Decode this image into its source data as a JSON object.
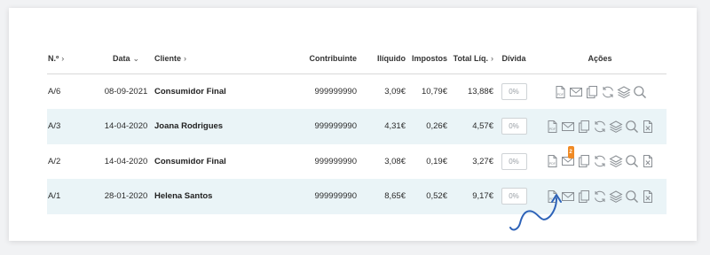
{
  "colors": {
    "accent": "#2d62b8",
    "badge": "#f08a24",
    "row_shade": "#eaf4f7"
  },
  "headers": {
    "numero": "N.º",
    "data": "Data",
    "cliente": "Cliente",
    "contribuinte": "Contribuinte",
    "iliquido": "Ilíquido",
    "impostos": "Impostos",
    "total": "Total Líq.",
    "divida": "Dívida",
    "acoes": "Ações"
  },
  "rows": [
    {
      "numero": "A/6",
      "data": "08-09-2021",
      "cliente": "Consumidor Final",
      "contribuinte": "999999990",
      "iliquido": "3,09€",
      "impostos": "10,79€",
      "total": "13,88€",
      "divida": "0%"
    },
    {
      "numero": "A/3",
      "data": "14-04-2020",
      "cliente": "Joana Rodrigues",
      "contribuinte": "999999990",
      "iliquido": "4,31€",
      "impostos": "0,26€",
      "total": "4,57€",
      "divida": "0%"
    },
    {
      "numero": "A/2",
      "data": "14-04-2020",
      "cliente": "Consumidor Final",
      "contribuinte": "999999990",
      "iliquido": "3,08€",
      "impostos": "0,19€",
      "total": "3,27€",
      "divida": "0%"
    },
    {
      "numero": "A/1",
      "data": "28-01-2020",
      "cliente": "Helena Santos",
      "contribuinte": "999999990",
      "iliquido": "8,65€",
      "impostos": "0,52€",
      "total": "9,17€",
      "divida": "0%"
    }
  ],
  "icons": [
    "pdf-icon",
    "email-icon",
    "copy-icon",
    "sync-icon",
    "layers-icon",
    "search-icon",
    "cancel-document-icon"
  ],
  "badge_text": "2"
}
